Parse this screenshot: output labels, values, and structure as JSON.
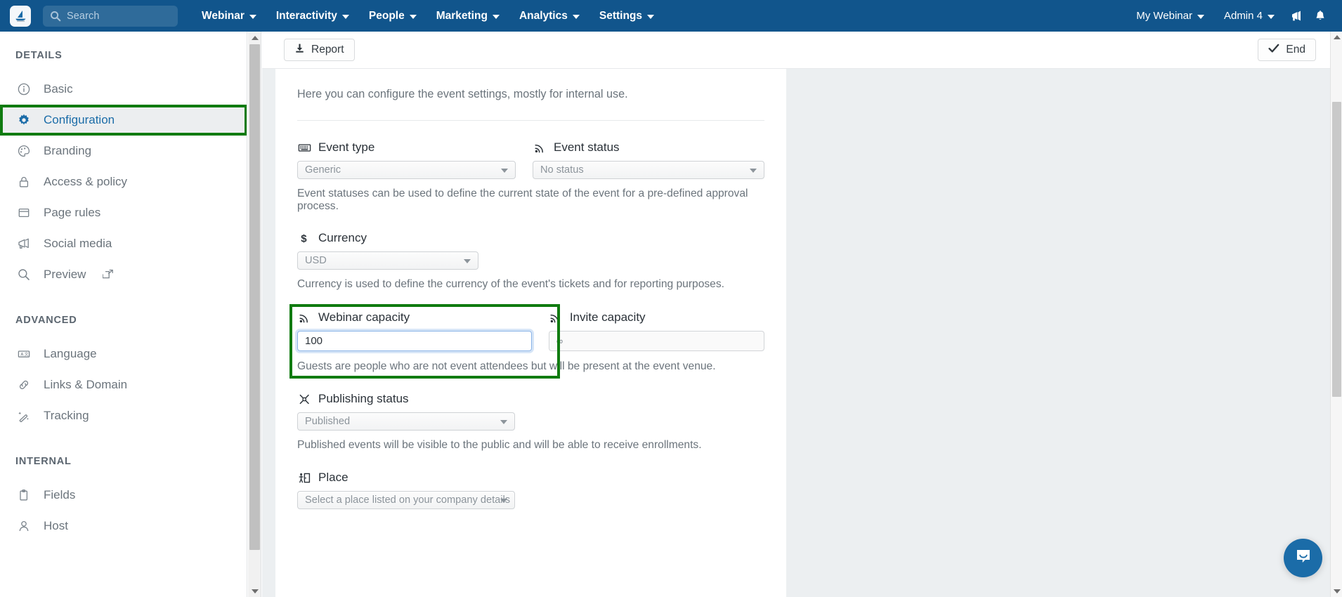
{
  "topnav": {
    "logo_alt": "app-logo",
    "search": {
      "placeholder": "Search"
    },
    "items": [
      {
        "label": "Webinar",
        "caret": true
      },
      {
        "label": "Interactivity",
        "caret": true
      },
      {
        "label": "People",
        "caret": true
      },
      {
        "label": "Marketing",
        "caret": true
      },
      {
        "label": "Analytics",
        "caret": true
      },
      {
        "label": "Settings",
        "caret": true
      }
    ],
    "right": [
      {
        "label": "My Webinar",
        "caret": true
      },
      {
        "label": "Admin 4",
        "caret": true
      }
    ],
    "icons": [
      "megaphone-icon",
      "bell-icon"
    ]
  },
  "sidebar": {
    "sections": [
      {
        "title": "DETAILS",
        "items": [
          {
            "label": "Basic",
            "icon": "info-circle-icon",
            "active": false
          },
          {
            "label": "Configuration",
            "icon": "gear-icon",
            "active": true
          },
          {
            "label": "Branding",
            "icon": "palette-icon",
            "active": false
          },
          {
            "label": "Access & policy",
            "icon": "lock-icon",
            "active": false
          },
          {
            "label": "Page rules",
            "icon": "window-icon",
            "active": false
          },
          {
            "label": "Social media",
            "icon": "megaphone-icon",
            "active": false
          },
          {
            "label": "Preview",
            "icon": "search-icon",
            "active": false,
            "external": true
          }
        ]
      },
      {
        "title": "ADVANCED",
        "items": [
          {
            "label": "Language",
            "icon": "translate-icon",
            "active": false
          },
          {
            "label": "Links & Domain",
            "icon": "link-icon",
            "active": false
          },
          {
            "label": "Tracking",
            "icon": "magic-wand-icon",
            "active": false
          }
        ]
      },
      {
        "title": "INTERNAL",
        "items": [
          {
            "label": "Fields",
            "icon": "clipboard-icon",
            "active": false
          },
          {
            "label": "Host",
            "icon": "person-icon",
            "active": false
          }
        ]
      }
    ],
    "highlight_color": "#107b10"
  },
  "toolbar": {
    "report_label": "Report",
    "report_icon": "download-icon",
    "end_label": "End",
    "end_icon": "check-icon"
  },
  "main": {
    "intro": "Here you can configure the event settings, mostly for internal use.",
    "fields": {
      "event_type": {
        "label": "Event type",
        "icon": "keyboard-icon",
        "value": "Generic"
      },
      "event_status": {
        "label": "Event status",
        "icon": "broadcast-icon",
        "value": "No status",
        "hint": "Event statuses can be used to define the current state of the event for a pre-defined approval process."
      },
      "currency": {
        "label": "Currency",
        "icon": "dollar-icon",
        "value": "USD",
        "hint": "Currency is used to define the currency of the event's tickets and for reporting purposes."
      },
      "webinar_capacity": {
        "label": "Webinar capacity",
        "icon": "broadcast-icon",
        "value": "100",
        "focused": true,
        "highlighted": true,
        "hint": "Guests are people who are not event attendees but will be present at the event venue."
      },
      "invite_capacity": {
        "label": "Invite capacity",
        "icon": "broadcast-icon",
        "value": "∞"
      },
      "publishing_status": {
        "label": "Publishing status",
        "icon": "shuffle-icon",
        "value": "Published",
        "hint": "Published events will be visible to the public and will be able to receive enrollments."
      },
      "place": {
        "label": "Place",
        "icon": "place-exit-icon",
        "value": "Select a place listed on your company details"
      }
    }
  },
  "chat": {
    "icon": "intercom-chat-icon",
    "color": "#1b6ca8"
  },
  "colors": {
    "navbar": "#11558c",
    "accent": "#1b6ca8",
    "highlight": "#107b10",
    "page_bg": "#eceff1"
  }
}
